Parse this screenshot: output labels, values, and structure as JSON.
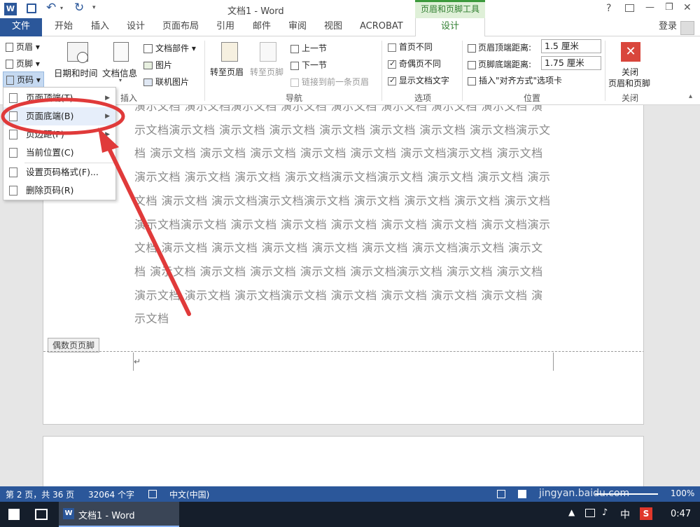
{
  "titlebar": {
    "title": "文档1 - Word",
    "context_tool": "页眉和页脚工具",
    "help": "?",
    "min": "—",
    "restore": "❐",
    "close": "✕"
  },
  "tabs": {
    "file": "文件",
    "home": "开始",
    "insert": "插入",
    "design_tab": "设计",
    "layout": "页面布局",
    "references": "引用",
    "mailings": "邮件",
    "review": "审阅",
    "view": "视图",
    "acrobat": "ACROBAT",
    "hf_design": "设计",
    "login": "登录"
  },
  "ribbon": {
    "header": "页眉",
    "footer": "页脚",
    "page_number": "页码",
    "date_time": "日期和时间",
    "doc_info": "文档信息",
    "doc_parts": "文档部件",
    "picture": "图片",
    "online_picture": "联机图片",
    "insert_group": "插入",
    "goto_header": "转至页眉",
    "goto_footer": "转至页脚",
    "prev": "上一节",
    "next": "下一节",
    "link_prev": "链接到前一条页眉",
    "nav_group": "导航",
    "diff_first": "首页不同",
    "diff_odd_even": "奇偶页不同",
    "show_text": "显示文档文字",
    "options_group": "选项",
    "header_top_label": "页眉顶端距离:",
    "header_top_value": "1.5 厘米",
    "footer_bottom_label": "页脚底端距离:",
    "footer_bottom_value": "1.75 厘米",
    "insert_align_tab": "插入\"对齐方式\"选项卡",
    "position_group": "位置",
    "close_line1": "关闭",
    "close_line2": "页眉和页脚",
    "close_group": "关闭"
  },
  "menu": {
    "items": [
      {
        "label": "页面顶端(T)"
      },
      {
        "label": "页面底端(B)"
      },
      {
        "label": "页边距(P)"
      },
      {
        "label": "当前位置(C)"
      },
      {
        "label": "设置页码格式(F)..."
      },
      {
        "label": "删除页码(R)"
      }
    ]
  },
  "document": {
    "body_text": "演示文档 演示文档演示文档 演示文档 演示文档 演示文档 演示文档 演示文档 演示文档演示文档 演示文档 演示文档 演示文档 演示文档 演示文档 演示文档演示文档 演示文档 演示文档 演示文档 演示文档 演示文档 演示文档演示文档 演示文档 演示文档 演示文档 演示文档 演示文档演示文档演示文档 演示文档 演示文档 演示文档 演示文档 演示文档演示文档演示文档 演示文档 演示文档 演示文档 演示文档 演示文档演示文档 演示文档 演示文档 演示文档 演示文档 演示文档 演示文档演示文档 演示文档 演示文档 演示文档 演示文档 演示文档 演示文档演示文档 演示文档 演示文档 演示文档 演示文档 演示文档 演示文档演示文档 演示文档 演示文档 演示文档 演示文档 演示文档演示文档 演示文档 演示文档 演示文档 演示文档 演示文档",
    "footer_tag": "偶数页页脚",
    "cursor": "↵"
  },
  "status": {
    "page": "第 2 页，共 36 页",
    "words": "32064 个字",
    "lang": "中文(中国)",
    "zoom": "100%"
  },
  "taskbar": {
    "app": "文档1 - Word",
    "time": "0:47",
    "ime": "中",
    "watermark": "Baidu 经验",
    "watermark_url": "jingyan.baidu.com"
  },
  "colors": {
    "accent": "#2b579a",
    "context": "#3c9a3c",
    "arrow": "#e03a3a"
  }
}
